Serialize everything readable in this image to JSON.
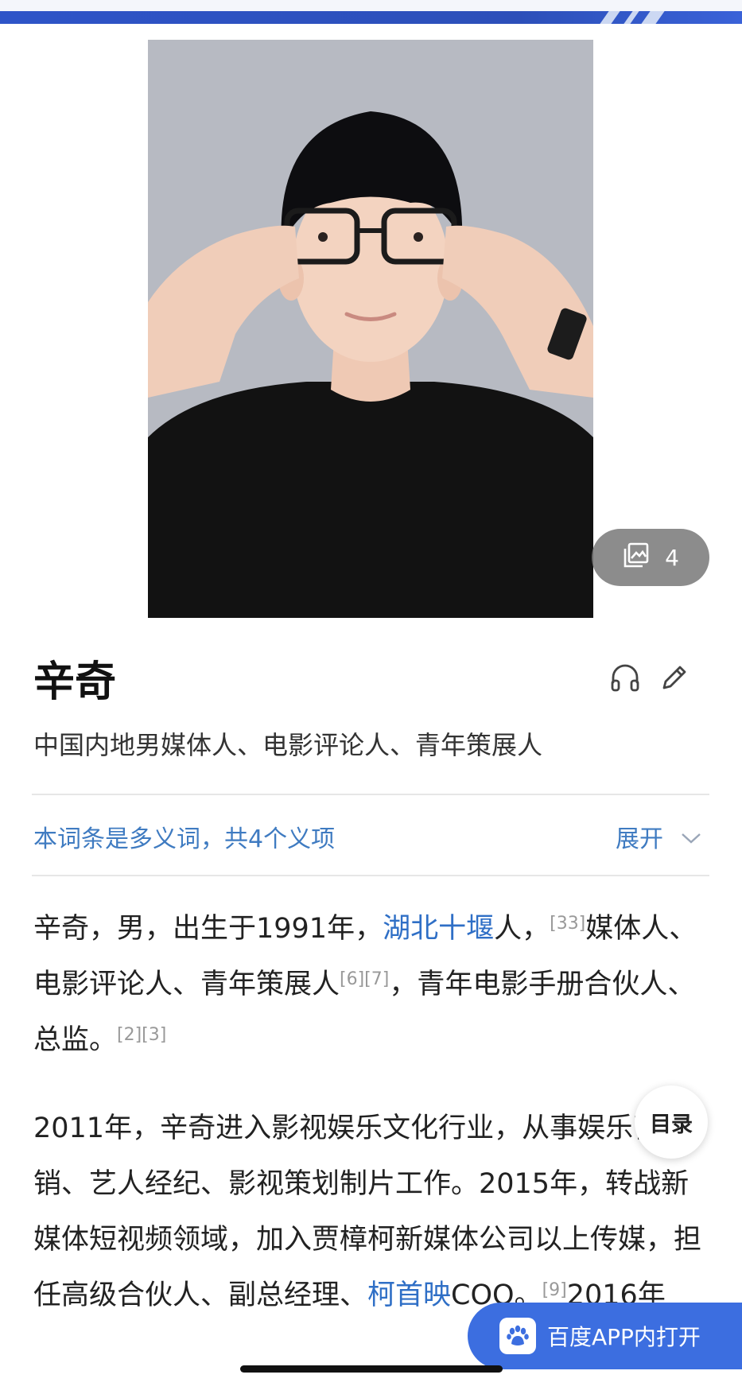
{
  "gallery": {
    "count": "4"
  },
  "entry": {
    "title": "辛奇",
    "subtitle": "中国内地男媒体人、电影评论人、青年策展人"
  },
  "polysemy": {
    "text": "本词条是多义词，共4个义项",
    "expand_label": "展开"
  },
  "paragraph1": {
    "t1": "辛奇，男，出生于1991年，",
    "link1": "湖北十堰",
    "t2": "人，",
    "ref1": "[33]",
    "t3": "媒体人、电影评论人、青年策展人",
    "ref2": "[6][7]",
    "t4": "，青年电影手册合伙人、总监。",
    "ref3": "[2][3]"
  },
  "paragraph2": {
    "t1": "2011年，辛奇进入影视娱乐文化行业，从事娱乐营销、艺人经纪、影视策划制片工作。2015年，转战新媒体短视频领域，加入贾樟柯新媒体公司以上传媒，担任高级合伙人、副总经理、",
    "link1": "柯首映",
    "t2": "COO。",
    "ref1": "[9]",
    "t3": "2016年"
  },
  "toc": {
    "label": "目录"
  },
  "app_open": {
    "label": "百度APP内打开"
  },
  "icons": {
    "gallery": "image-gallery-icon",
    "listen": "headphones-icon",
    "edit": "pencil-icon",
    "expand": "chevron-down-icon",
    "app": "baidu-paw-icon"
  },
  "colors": {
    "link": "#2f6fc6",
    "polysemy": "#3f7bc1",
    "app_button": "#3c6ee0",
    "banner": "#2e54c8"
  }
}
